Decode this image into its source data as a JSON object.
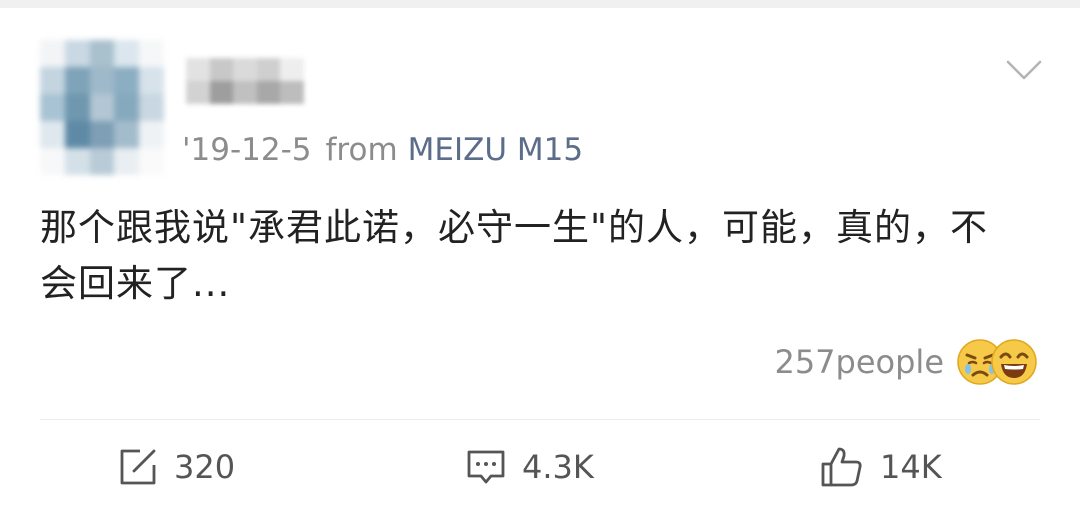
{
  "post": {
    "meta": {
      "date": "'19-12-5",
      "from_label": "from",
      "device": "MEIZU M15"
    },
    "content": "那个跟我说\"承君此诺，必守一生\"的人，可能，真的，不会回来了...",
    "reactions": {
      "count_text": "257people",
      "emojis": [
        "sad-face-icon",
        "laughing-face-icon"
      ]
    },
    "actions": {
      "forward": {
        "icon": "share-icon",
        "count": "320"
      },
      "comment": {
        "icon": "comment-icon",
        "count": "4.3K"
      },
      "like": {
        "icon": "thumbs-up-icon",
        "count": "14K"
      }
    }
  },
  "colors": {
    "meta_text": "#8c8c8c",
    "device_link": "#5b6d88",
    "body_text": "#222222",
    "divider": "#ececec"
  }
}
